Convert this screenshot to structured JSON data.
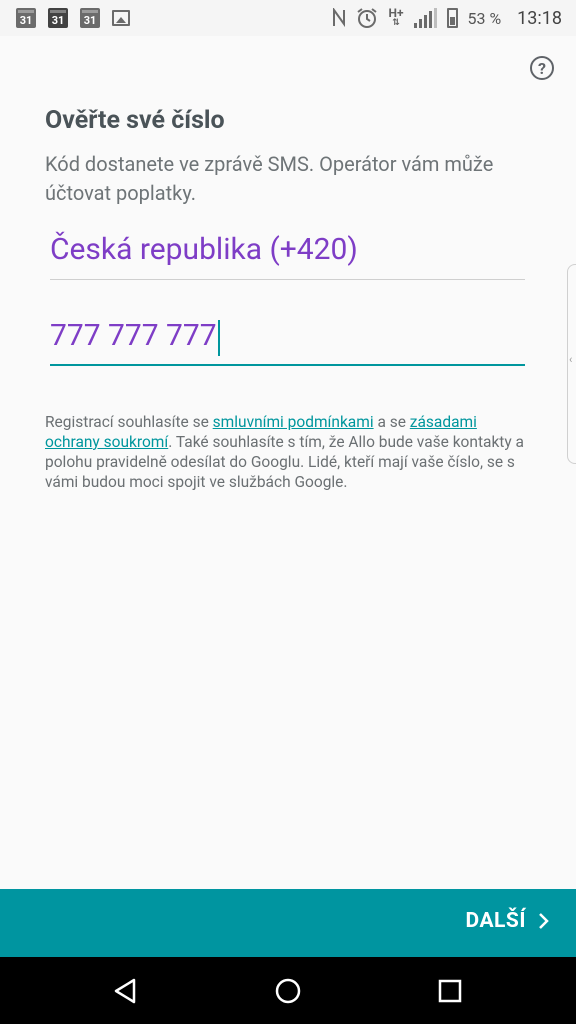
{
  "status_bar": {
    "calendar_icons": [
      "31",
      "31",
      "31"
    ],
    "battery_percent": "53 %",
    "time": "13:18",
    "network": "H+"
  },
  "help_icon": "?",
  "title": "Ověřte své číslo",
  "subtitle": "Kód dostanete ve zprávě SMS. Operátor vám může účtovat poplatky.",
  "country_field": {
    "value": "Česká republika (+420)"
  },
  "phone_field": {
    "value": "777 777 777"
  },
  "legal": {
    "part1": "Registrací souhlasíte se ",
    "link_terms": "smluvními podmínkami",
    "part2": " a se ",
    "link_privacy": "zásadami ochrany soukromí",
    "part3": ". Také souhlasíte s tím, že Allo bude vaše kontakty a polohu pravidelně odesílat do Googlu. Lidé, kteří mají vaše číslo, se s vámi budou moci spojit ve službách Google."
  },
  "next_button": {
    "label": "DALŠÍ"
  },
  "colors": {
    "accent": "#00969d",
    "field_text": "#7e3dc6",
    "bottom_bar": "#0095a0"
  }
}
